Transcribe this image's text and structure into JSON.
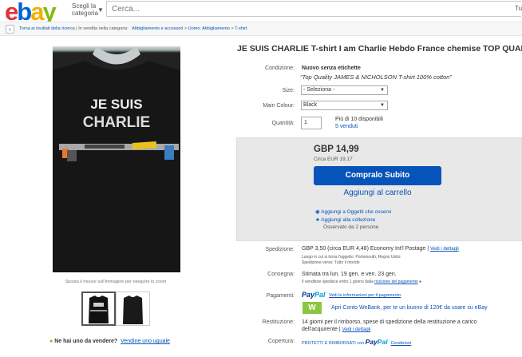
{
  "header": {
    "logo": [
      "e",
      "b",
      "a",
      "y"
    ],
    "category_label": "Scegli la categoria",
    "search_placeholder": "Cerca...",
    "search_button_text": "Tu"
  },
  "breadcrumb": {
    "back_label": "Torna ai risultati della ricerca",
    "sep": " | ",
    "sold_in": "In vendita nella categoria:",
    "path": [
      "Abbigliamento e accessori",
      "Uomo: Abbigliamento",
      "T-shirt"
    ]
  },
  "product": {
    "title": "JE SUIS CHARLIE T-shirt I am Charlie Hebdo France chemise TOP QUALITY",
    "shirt_text_line1": "JE SUIS",
    "shirt_text_line2": "CHARLIE",
    "zoom_hint": "Sposta il mouse sull'immagine per eseguire lo zoom",
    "sell_prompt": "Ne hai uno da vendere?",
    "sell_link": "Vendine uno uguale"
  },
  "details": {
    "condition_label": "Condizione:",
    "condition_value": "Nuovo senza etichette",
    "condition_note": "“Top Quality JAMES & NICHOLSON T-shirt 100% cotton”",
    "size_label": "Size:",
    "size_value": "- Seleziona -",
    "colour_label": "Main Colour:",
    "colour_value": "Black",
    "qty_label": "Quantità:",
    "qty_value": "1",
    "availability": "Più di 10 disponibili",
    "sold": "5 venduti"
  },
  "buy": {
    "price": "GBP 14,99",
    "approx": "Circa EUR 19,17",
    "buy_now": "Compralo Subito",
    "add_cart": "Aggiungi al carrello",
    "watch_add": "Aggiungi a Oggetti che osservi",
    "collection_add": "Aggiungi alla collezione",
    "watchers": "Osservato da 2 persone"
  },
  "shipping": {
    "label": "Spedizione:",
    "value": "GBP 3,50 (circa EUR 4,48)  Economy Int'l Postage",
    "details_link": "Vedi i dettagli",
    "location": "Luogo in cui si trova l'oggetto:  Portsmouth, Regno Unito",
    "ships_to": "Spedizione verso:  Tutto il mondo"
  },
  "delivery": {
    "label": "Consegna:",
    "value": "Stimata tra lun. 19 gen. e ven. 23 gen.",
    "note": "Il venditore spedisce entro 1 giorno dalla",
    "note_link": "ricezione del pagamento"
  },
  "payments": {
    "label": "Pagamenti:",
    "paypal": [
      "Pay",
      "Pal"
    ],
    "info_link": "Vedi le informazioni per il pagamento",
    "webank_icon": "W",
    "webank_text": "Apri Conto WeBank, per te un buono di 120€ da usare su eBay"
  },
  "returns": {
    "label": "Restituzione:",
    "value": "14 giorni per il rimborso, spese di spedizione della restituzione a carico dell'acquirente",
    "details_link": "Vedi i dettagli"
  },
  "coverage": {
    "label": "Copertura:",
    "prefix": "PROTETTI E RIMBORSATI con",
    "paypal": [
      "Pay",
      "Pal"
    ],
    "conditions": "Condizioni"
  },
  "colors": {
    "link": "#0654ba",
    "buy_button": "#0654ba",
    "buybox_bg": "#e8e8e8",
    "webank": "#8cc63f"
  }
}
